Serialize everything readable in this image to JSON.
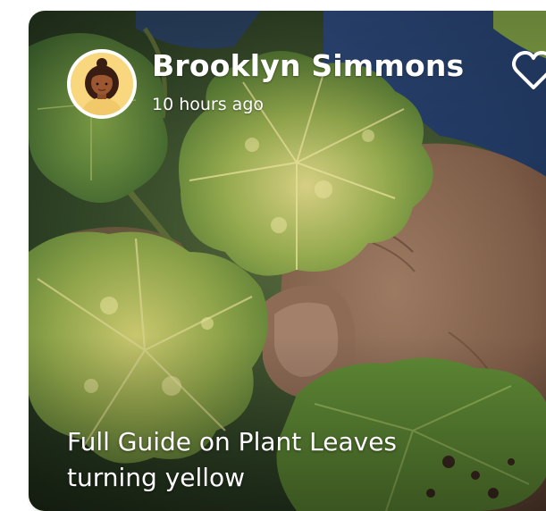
{
  "post": {
    "author": {
      "name": "Brooklyn Simmons",
      "time": "10 hours ago",
      "avatar_bg": "#f9d77e"
    },
    "title": "Full Guide on Plant Leaves turning yellow",
    "like_icon": "heart-icon",
    "photo": "leaf-in-hand-photo"
  }
}
